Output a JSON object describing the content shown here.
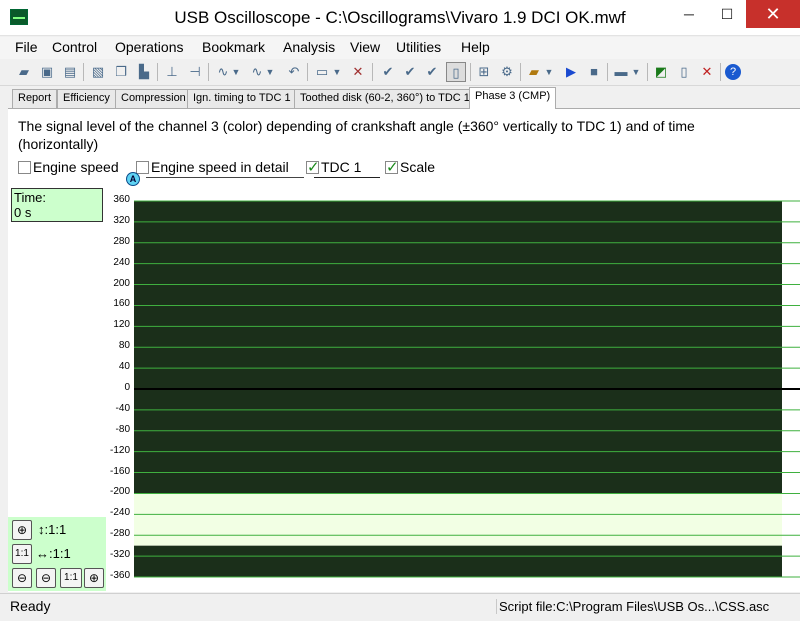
{
  "window": {
    "title": "USB Oscilloscope - C:\\Oscillograms\\Vivaro 1.9 DCI OK.mwf",
    "min_label": "─",
    "max_label": "☐",
    "close_label": "✕"
  },
  "menu": [
    "File",
    "Control",
    "Operations",
    "Bookmark",
    "Analysis",
    "View",
    "Utilities",
    "Help"
  ],
  "toolbar": {
    "icons": [
      "open-icon",
      "save-icon",
      "print-icon",
      "image-export-icon",
      "copy-icon",
      "paste-icon",
      "cursor-icon",
      "measure-icon",
      "filter-icon",
      "filter-2-icon",
      "undo-icon",
      "view-icon",
      "delete-icon",
      "check-icon",
      "check-all-icon",
      "check-more-icon",
      "page-icon",
      "zoom-icon",
      "settings-icon",
      "folder-icon",
      "play-icon",
      "stop-icon",
      "panel-icon",
      "chart-icon",
      "document-icon",
      "close-doc-icon",
      "help-icon"
    ]
  },
  "tabs": [
    {
      "label": "Report"
    },
    {
      "label": "Efficiency"
    },
    {
      "label": "Compression"
    },
    {
      "label": "Ign. timing to TDC 1"
    },
    {
      "label": "Toothed disk (60-2, 360°) to TDC 1"
    },
    {
      "label": "Phase 3 (CMP)"
    }
  ],
  "active_tab": "Phase 3 (CMP)",
  "description": "The signal level of the channel 3 (color) depending of crankshaft angle (±360° vertically to TDC 1) and of time (horizontally)",
  "checkboxes": [
    {
      "label": "Engine speed",
      "checked": false
    },
    {
      "label": "Engine speed in detail",
      "checked": false
    },
    {
      "label": "TDC 1",
      "checked": true
    },
    {
      "label": "Scale",
      "checked": true
    }
  ],
  "time_box": {
    "label": "Time:",
    "value": "0 s"
  },
  "marker_label": "A",
  "zoom": {
    "zoom_in": "⊕",
    "zoom_out": "⊖",
    "reset": "1:1",
    "vertical_label": "↕:1:1",
    "horizontal_label": "↔:1:1"
  },
  "chart_data": {
    "type": "heatmap",
    "y_ticks": [
      "360",
      "320",
      "280",
      "240",
      "200",
      "160",
      "120",
      "80",
      "40",
      "0",
      "-40",
      "-80",
      "-120",
      "-160",
      "-200",
      "-240",
      "-280",
      "-320",
      "-360"
    ],
    "ylim": [
      -360,
      360
    ],
    "bands": [
      {
        "from": 360,
        "to": -200,
        "color": "#1b2f1a"
      },
      {
        "from": -200,
        "to": -300,
        "color": "#f2ffe4"
      },
      {
        "from": -300,
        "to": -360,
        "color": "#1b2f1a"
      }
    ],
    "grid_color": "#3fb03f",
    "zero_line_color": "#000000"
  },
  "status": {
    "left": "Ready",
    "right": "Script file:C:\\Program Files\\USB Os...\\CSS.asc"
  }
}
